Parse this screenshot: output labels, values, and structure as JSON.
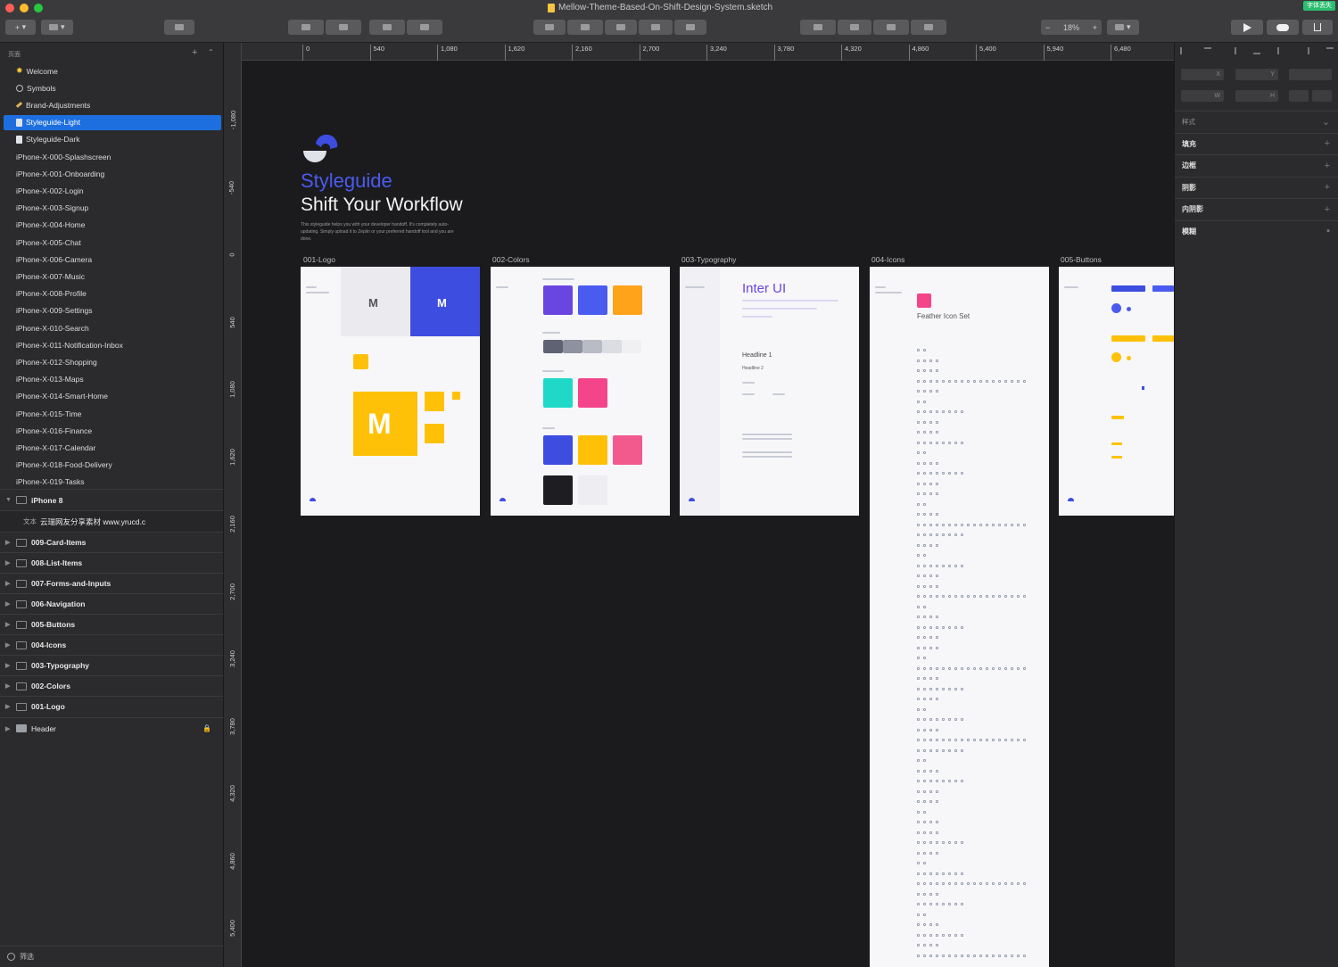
{
  "window": {
    "title": "Mellow-Theme-Based-On-Shift-Design-System.sketch",
    "badge": "字体丢失",
    "zoom": "18%",
    "colors": {
      "close": "#fe5f57",
      "minimize": "#febc2e",
      "maximize": "#28c840"
    }
  },
  "toolbar": {
    "insert_label": "+",
    "zoom_minus": "−",
    "zoom_plus": "+"
  },
  "sidebar": {
    "header": "页面",
    "pages": [
      {
        "label": "Welcome",
        "icon": "star-icon"
      },
      {
        "label": "Symbols",
        "icon": "gear-icon"
      },
      {
        "label": "Brand-Adjustments",
        "icon": "pencil-icon"
      },
      {
        "label": "Styleguide-Light",
        "icon": "document-icon",
        "selected": true
      },
      {
        "label": "Styleguide-Dark",
        "icon": "document-icon"
      },
      {
        "label": "iPhone-X-000-Splashscreen"
      },
      {
        "label": "iPhone-X-001-Onboarding"
      },
      {
        "label": "iPhone-X-002-Login"
      },
      {
        "label": "iPhone-X-003-Signup"
      },
      {
        "label": "iPhone-X-004-Home"
      },
      {
        "label": "iPhone-X-005-Chat"
      },
      {
        "label": "iPhone-X-006-Camera"
      },
      {
        "label": "iPhone-X-007-Music"
      },
      {
        "label": "iPhone-X-008-Profile"
      },
      {
        "label": "iPhone-X-009-Settings"
      },
      {
        "label": "iPhone-X-010-Search"
      },
      {
        "label": "iPhone-X-011-Notification-Inbox"
      },
      {
        "label": "iPhone-X-012-Shopping"
      },
      {
        "label": "iPhone-X-013-Maps"
      },
      {
        "label": "iPhone-X-014-Smart-Home"
      },
      {
        "label": "iPhone-X-015-Time"
      },
      {
        "label": "iPhone-X-016-Finance"
      },
      {
        "label": "iPhone-X-017-Calendar"
      },
      {
        "label": "iPhone-X-018-Food-Delivery"
      },
      {
        "label": "iPhone-X-019-Tasks"
      }
    ],
    "group": {
      "label": "iPhone 8",
      "child_prefix": "文本",
      "child_label": "云瑞网友分享素材 www.yrucd.c"
    },
    "layers": [
      "009-Card-Items",
      "008-List-Items",
      "007-Forms-and-Inputs",
      "006-Navigation",
      "005-Buttons",
      "004-Icons",
      "003-Typography",
      "002-Colors",
      "001-Logo"
    ],
    "header_layer": "Header",
    "filter_label": "筛选"
  },
  "ruler": {
    "h": [
      "0",
      "540",
      "1,080",
      "1,620",
      "2,160",
      "2,700",
      "3,240",
      "3,780",
      "4,320",
      "4,860",
      "5,400",
      "5,940",
      "6,480"
    ],
    "v": [
      "-1,080",
      "-540",
      "0",
      "540",
      "1,080",
      "1,620",
      "2,160",
      "2,700",
      "3,240",
      "3,780",
      "4,320",
      "4,860",
      "5,400"
    ]
  },
  "canvas": {
    "hero_title": "Styleguide",
    "hero_subtitle": "Shift Your Workflow",
    "hero_desc": "This styleguide helps you with your developer handoff. It's completely auto-updating. Simply upload it to Zeplin or your preferred handoff tool and you are done.",
    "artboards": [
      "001-Logo",
      "002-Colors",
      "003-Typography",
      "004-Icons",
      "005-Buttons"
    ],
    "typo_font": "Inter UI",
    "typo_h1": "Headline 1",
    "typo_h2": "Headline 2",
    "icons_title": "Feather Icon Set",
    "colors": {
      "accent": "#3d4de0",
      "purple": "#6a46e0",
      "blue": "#4a5cf0",
      "orange": "#ffa31a",
      "yellow": "#ffc107",
      "teal": "#1fd8c8",
      "pink": "#f4448a"
    }
  },
  "inspector": {
    "x": "X",
    "y": "Y",
    "w": "W",
    "h": "H",
    "sections": [
      "样式",
      "填充",
      "边框",
      "阴影",
      "内阴影",
      "模糊"
    ]
  }
}
